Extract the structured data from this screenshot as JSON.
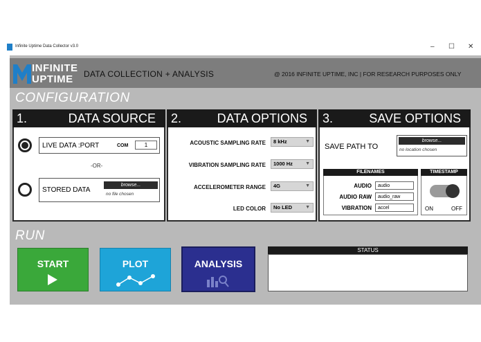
{
  "window": {
    "title": "Infinite Uptime Data Collector v3.0",
    "minimize": "–",
    "maximize": "☐",
    "close": "✕"
  },
  "header": {
    "logo_line1": "INFINITE",
    "logo_line2": "UPTIME",
    "title": "DATA COLLECTION + ANALYSIS",
    "copyright": "@ 2016 INFINITE UPTIME, INC | FOR RESEARCH PURPOSES ONLY"
  },
  "configuration": {
    "title": "CONFIGURATION",
    "data_source": {
      "number": "1.",
      "title": "DATA SOURCE",
      "live_label": "LIVE DATA :PORT",
      "com_label": "COM",
      "com_value": "1",
      "or_label": "-OR-",
      "stored_label": "STORED DATA",
      "browse_label": "browse...",
      "file_status": "no file chosen",
      "selected": "live"
    },
    "data_options": {
      "number": "2.",
      "title": "DATA OPTIONS",
      "rows": [
        {
          "label": "ACOUSTIC SAMPLING RATE",
          "value": "8 kHz"
        },
        {
          "label": "VIBRATION SAMPLING RATE",
          "value": "1000 Hz"
        },
        {
          "label": "ACCELEROMETER RANGE",
          "value": "4G"
        },
        {
          "label": "LED COLOR",
          "value": "No LED"
        }
      ]
    },
    "save_options": {
      "number": "3.",
      "title": "SAVE OPTIONS",
      "save_path_label": "SAVE PATH TO",
      "browse_label": "browse...",
      "location_status": "no location chosen",
      "filenames_title": "FILENAMES",
      "filenames": [
        {
          "label": "AUDIO",
          "value": "audio"
        },
        {
          "label": "AUDIO RAW",
          "value": "audio_raw"
        },
        {
          "label": "VIBRATION",
          "value": "accel"
        }
      ],
      "timestamp_title": "TIMESTAMP",
      "toggle_on": "ON",
      "toggle_off": "OFF",
      "timestamp_state": "off"
    }
  },
  "run": {
    "title": "RUN",
    "start_label": "START",
    "plot_label": "PLOT",
    "analysis_label": "ANALYSIS",
    "status_title": "STATUS",
    "colors": {
      "start": "#3aa83a",
      "plot": "#1ea4d8",
      "analysis": "#2b2f8f"
    }
  }
}
